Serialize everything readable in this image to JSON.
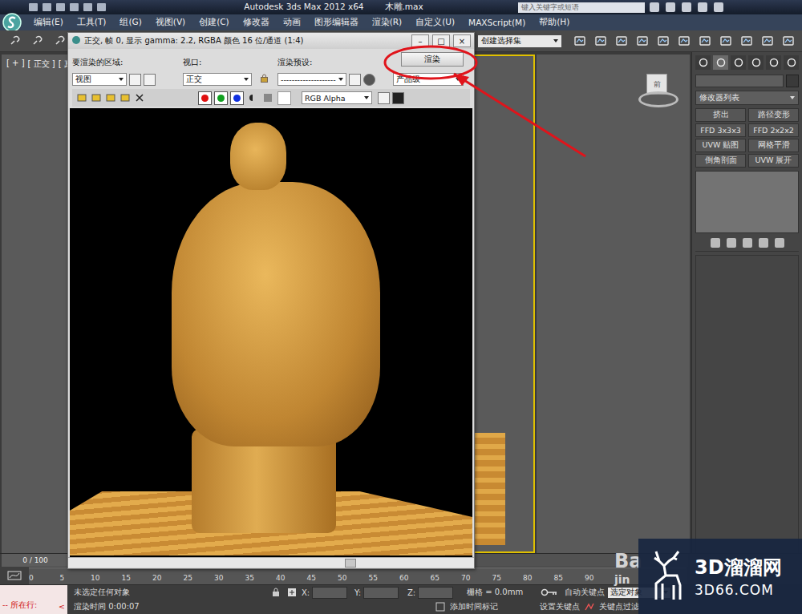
{
  "window": {
    "title": "Autodesk 3ds Max  2012 x64",
    "file": "木雕.max"
  },
  "search": {
    "placeholder": "键入关键字或短语"
  },
  "menu": [
    "编辑(E)",
    "工具(T)",
    "组(G)",
    "视图(V)",
    "创建(C)",
    "修改器",
    "动画",
    "图形编辑器",
    "渲染(R)",
    "自定义(U)",
    "MAXScript(M)",
    "帮助(H)"
  ],
  "toolbar": {
    "selection_set": "创建选择集"
  },
  "viewport_labels": [
    "[ + ]",
    "[ 正交 ]",
    "[ 真实"
  ],
  "viewports": [
    {
      "active": false
    },
    {
      "active": true
    },
    {
      "active": false
    }
  ],
  "viewcube": {
    "label": "前"
  },
  "render_window": {
    "title": "正交, 帧 0, 显示 gamma: 2.2, RGBA 颜色 16 位/通道 (1:4)",
    "window_buttons": [
      "–",
      "□",
      "×"
    ],
    "area_label": "要渲染的区域:",
    "area": "视图",
    "viewport_label": "视口:",
    "viewport": "正交",
    "preset_label": "渲染预设:",
    "preset": "--------------------",
    "render_button": "渲染",
    "quality": "产品级",
    "channels": [
      {
        "on": true,
        "color": "#e01010"
      },
      {
        "on": true,
        "color": "#10a020"
      },
      {
        "on": true,
        "color": "#1030e0"
      }
    ],
    "display": "RGB Alpha"
  },
  "command_panel": {
    "modifier_list": "修改器列表",
    "buttons": [
      "挤出",
      "路径变形",
      "FFD 3x3x3",
      "FFD 2x2x2",
      "UVW 贴图",
      "网格平滑",
      "倒角剖面",
      "UVW 展开"
    ]
  },
  "timeline": {
    "frame": "0 / 100",
    "ticks": [
      "0",
      "5",
      "10",
      "15",
      "20",
      "25",
      "30",
      "35",
      "40",
      "45",
      "50",
      "55",
      "60",
      "65",
      "70",
      "75",
      "80",
      "85",
      "90"
    ]
  },
  "status": {
    "script": "--  所在行:",
    "script_arrow": "<",
    "selection": "未选定任何对象",
    "render_time": "渲染时间  0:00:07",
    "x": "X:",
    "y": "Y:",
    "z": "Z:",
    "grid": "栅格 = 0.0mm",
    "auto_key": "自动关键点",
    "key_target": "选定对象",
    "add_tag": "添加时间标记",
    "set_key": "设置关键点",
    "key_filter": "关键点过滤"
  },
  "watermark": {
    "brand": "3D溜溜网",
    "url": "3D66.COM",
    "baidu_top": "Ba",
    "baidu_bottom": "jin"
  }
}
